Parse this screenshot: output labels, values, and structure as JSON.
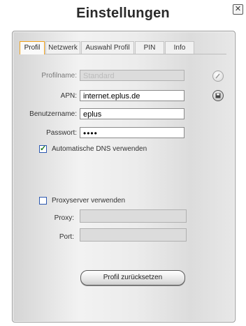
{
  "window": {
    "title": "Einstellungen"
  },
  "tabs": [
    {
      "label": "Profil",
      "active": true
    },
    {
      "label": "Netzwerk",
      "active": false
    },
    {
      "label": "Auswahl Profil",
      "active": false
    },
    {
      "label": "PIN",
      "active": false
    },
    {
      "label": "Info",
      "active": false
    }
  ],
  "profile": {
    "profilname_label": "Profilname:",
    "profilname_value": "Standard",
    "apn_label": "APN:",
    "apn_value": "internet.eplus.de",
    "benutzername_label": "Benutzername:",
    "benutzername_value": "eplus",
    "passwort_label": "Passwort:",
    "passwort_value": "••••"
  },
  "options": {
    "dns_label": "Automatische DNS verwenden",
    "dns_checked": true,
    "proxy_label": "Proxyserver verwenden",
    "proxy_checked": false
  },
  "proxy": {
    "proxy_label": "Proxy:",
    "proxy_value": "",
    "port_label": "Port:",
    "port_value": ""
  },
  "actions": {
    "reset_label": "Profil zurücksetzen"
  },
  "icons": {
    "close": "close-icon",
    "edit": "edit-icon",
    "save": "save-icon"
  },
  "colors": {
    "active_tab_border": "#f0a21c",
    "checkbox_border": "#2b58b0",
    "checkmark": "#1f7a1f"
  }
}
